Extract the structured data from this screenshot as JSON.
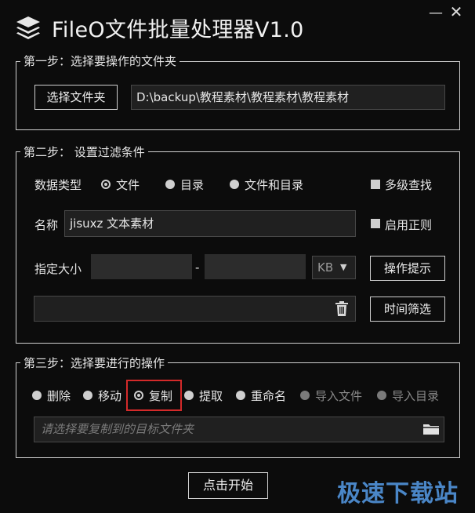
{
  "window": {
    "title": "FileO文件批量处理器V1.0",
    "minimize_label": "—",
    "close_label": "✕"
  },
  "step1": {
    "legend": "第一步：选择要操作的文件夹",
    "select_folder_label": "选择文件夹",
    "folder_path": "D:\\backup\\教程素材\\教程素材\\教程素材"
  },
  "step2": {
    "legend": "第二步： 设置过滤条件",
    "data_type_label": "数据类型",
    "options": [
      "文件",
      "目录",
      "文件和目录"
    ],
    "selected_option": "文件",
    "multilevel_label": "多级查找",
    "name_label": "名称",
    "name_value": "jisuxz 文本素材",
    "regex_label": "启用正则",
    "size_label": "指定大小",
    "size_separator": "-",
    "size_unit": "KB",
    "tips_label": "操作提示",
    "time_filter_label": "时间筛选"
  },
  "step3": {
    "legend": "第三步：选择要进行的操作",
    "operations": [
      "删除",
      "移动",
      "复制",
      "提取",
      "重命名",
      "导入文件",
      "导入目录"
    ],
    "selected_operation": "复制",
    "target_placeholder": "请选择要复制到的目标文件夹"
  },
  "start_label": "点击开始",
  "watermark": "极速下载站",
  "colors": {
    "highlight": "#d42a2a",
    "background": "#0c0c0c"
  }
}
